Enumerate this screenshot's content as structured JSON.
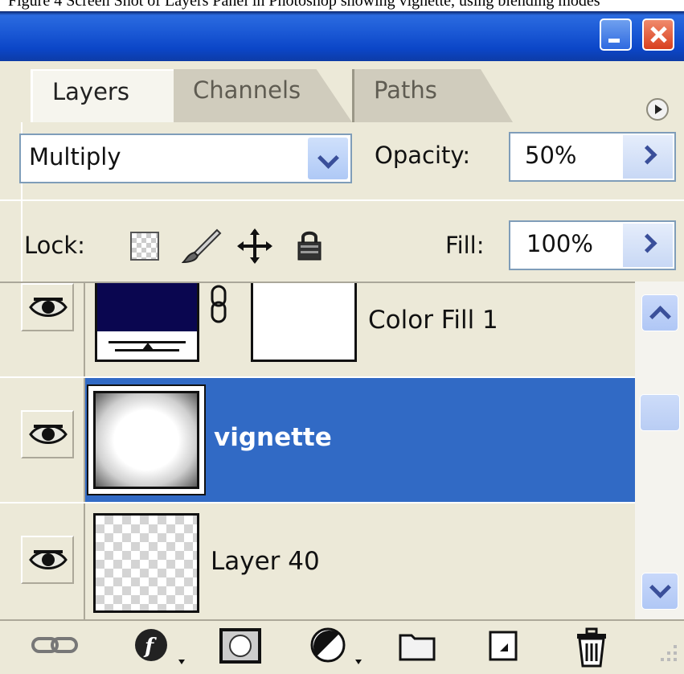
{
  "page_caption": "Figure 4 Screen Shot of Layers Panel in Photoshop showing vignette, using blending modes",
  "titlebar": {
    "minimize_icon": "minimize-icon",
    "close_icon": "close-icon"
  },
  "tabs": [
    {
      "label": "Layers",
      "active": true
    },
    {
      "label": "Channels",
      "active": false
    },
    {
      "label": "Paths",
      "active": false
    }
  ],
  "blend": {
    "mode": "Multiply",
    "opacity_label": "Opacity:",
    "opacity_value": "50%"
  },
  "lock": {
    "label": "Lock:",
    "fill_label": "Fill:",
    "fill_value": "100%"
  },
  "layers": [
    {
      "name": "Color Fill 1",
      "visible": true,
      "selected": false,
      "type": "fill-with-mask",
      "fill_color": "#0a0650"
    },
    {
      "name": "vignette",
      "visible": true,
      "selected": true,
      "type": "raster"
    },
    {
      "name": "Layer 40",
      "visible": true,
      "selected": false,
      "type": "transparent"
    }
  ],
  "colors": {
    "selection": "#316ac5",
    "panel": "#ece9d8",
    "titlebar": "#1c5ad6"
  },
  "bottom_icons": [
    "link-layers-icon",
    "layer-style-icon",
    "add-mask-icon",
    "adjustment-layer-icon",
    "new-group-icon",
    "new-layer-icon",
    "delete-layer-icon"
  ]
}
